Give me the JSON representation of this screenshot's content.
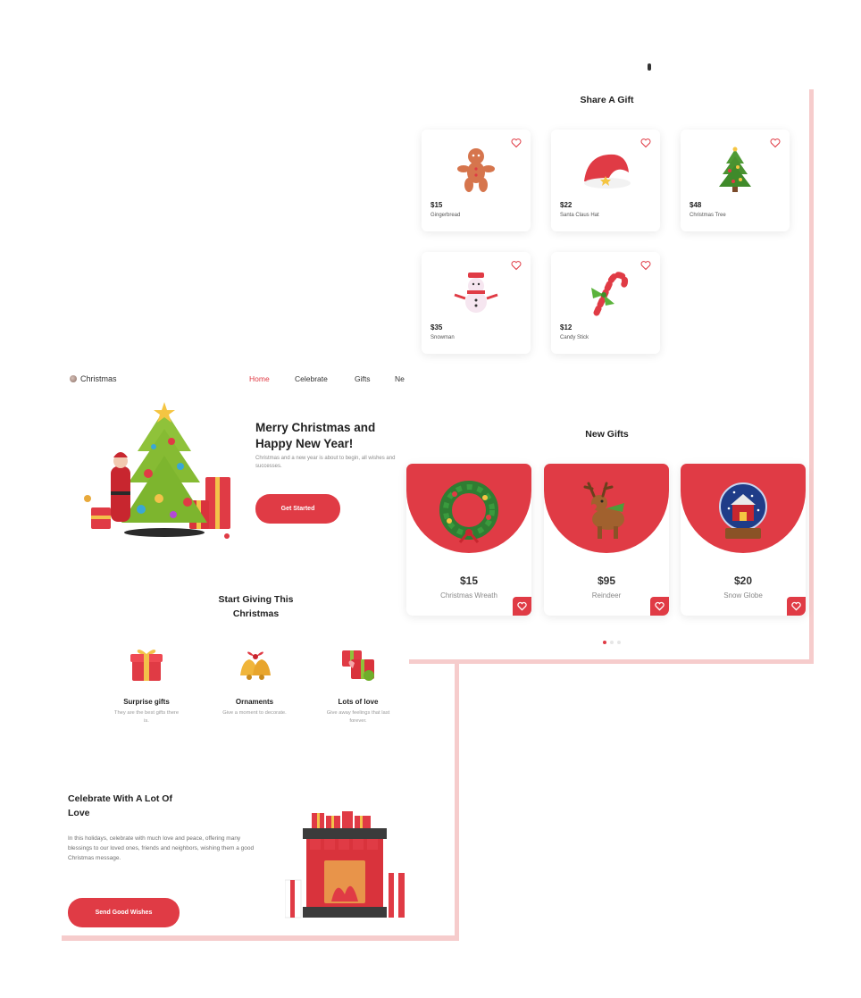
{
  "left_page": {
    "nav": {
      "brand": "Christmas",
      "links": [
        "Home",
        "Celebrate",
        "Gifts",
        "Ne"
      ]
    },
    "hero": {
      "title": "Merry Christmas and Happy New Year!",
      "subtitle": "Christmas and a new year is about to begin, all wishes and successes.",
      "button": "Get Started"
    },
    "giving": {
      "title": "Start Giving This Christmas",
      "features": [
        {
          "title": "Surprise gifts",
          "desc": "They are the best gifts there is.",
          "icon": "gift-box-icon"
        },
        {
          "title": "Ornaments",
          "desc": "Give a moment to decorate.",
          "icon": "bells-icon"
        },
        {
          "title": "Lots of love",
          "desc": "Give away feelings that last forever.",
          "icon": "gift-stack-icon"
        }
      ]
    },
    "celebrate": {
      "title": "Celebrate With A Lot Of Love",
      "text": "In this holidays, celebrate with much love and peace, offering many blessings to our loved ones, friends and neighbors, wishing them a good Christmas message.",
      "button": "Send Good Wishes"
    }
  },
  "right_page": {
    "share": {
      "title": "Share A Gift",
      "items": [
        {
          "price": "$15",
          "name": "Gingerbread",
          "icon": "gingerbread-icon"
        },
        {
          "price": "$22",
          "name": "Santa Claus Hat",
          "icon": "santa-hat-icon"
        },
        {
          "price": "$48",
          "name": "Christmas Tree",
          "icon": "christmas-tree-icon"
        },
        {
          "price": "$35",
          "name": "Snowman",
          "icon": "snowman-icon"
        },
        {
          "price": "$12",
          "name": "Candy Stick",
          "icon": "candy-cane-icon"
        }
      ]
    },
    "new_gifts": {
      "title": "New Gifts",
      "items": [
        {
          "price": "$15",
          "name": "Christmas Wreath",
          "icon": "wreath-icon"
        },
        {
          "price": "$95",
          "name": "Reindeer",
          "icon": "reindeer-icon"
        },
        {
          "price": "$20",
          "name": "Snow Globe",
          "icon": "snow-globe-icon"
        }
      ],
      "pagination": {
        "pages": 3,
        "active": 1
      }
    }
  },
  "colors": {
    "accent": "#e03b45",
    "shadow": "#f6cccc",
    "text": "#222222",
    "muted": "#8a8a8a"
  }
}
